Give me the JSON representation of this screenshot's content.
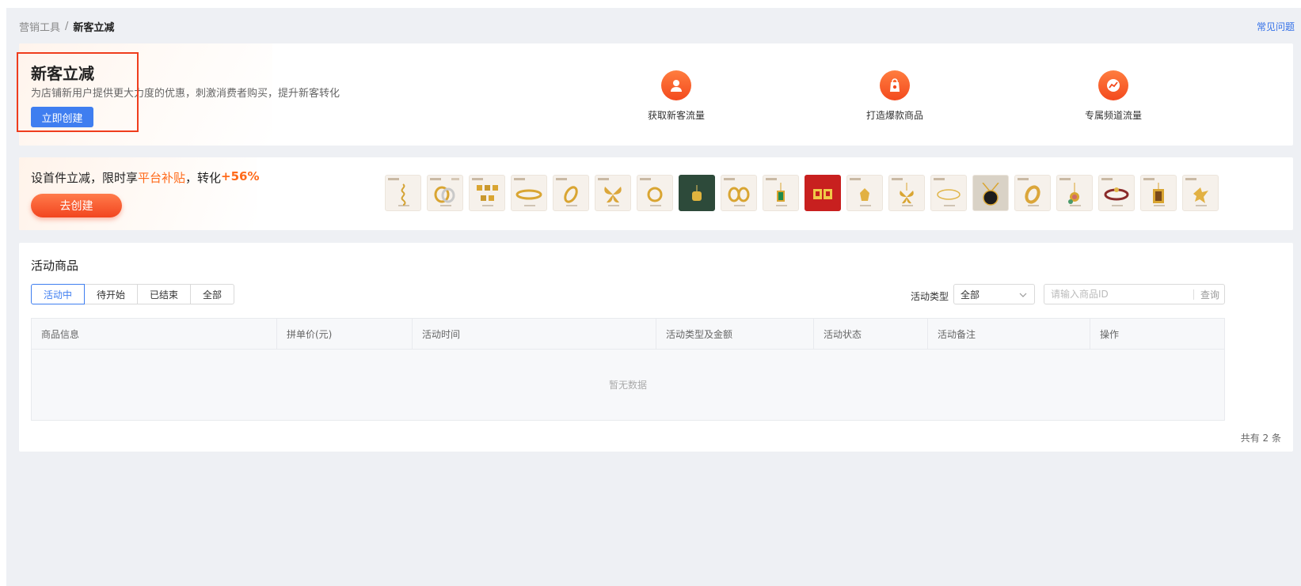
{
  "breadcrumb": {
    "parent": "营销工具",
    "separator": "/",
    "current": "新客立减"
  },
  "faq_link": "常见问题",
  "hero": {
    "title": "新客立减",
    "subtitle": "为店铺新用户提供更大力度的优惠，刺激消费者购买，提升新客转化",
    "create_button": "立即创建",
    "features": [
      {
        "label": "获取新客流量",
        "icon": "user-icon"
      },
      {
        "label": "打造爆款商品",
        "icon": "shopping-bag-icon"
      },
      {
        "label": "专属频道流量",
        "icon": "trend-icon"
      }
    ]
  },
  "promo": {
    "title_part1": "设首件立减，限时享",
    "title_highlight": "平台补贴",
    "title_part2": "，转化",
    "title_boost": "+56%",
    "go_button": "去创建",
    "product_thumbnails": [
      "snake-pendant-icon",
      "ring-pair-icon",
      "charm-set-icon",
      "bracelet-icon",
      "ring-icon",
      "butterfly-pendant-icon",
      "ring-icon",
      "gold-bead-icon",
      "earring-icon",
      "emerald-pendant-icon",
      "gold-bar-icon",
      "gold-ornament-icon",
      "butterfly-pendant-icon",
      "chain-bracelet-icon",
      "onyx-pendant-icon",
      "ring-icon",
      "flower-pendant-icon",
      "bead-bracelet-icon",
      "framed-pendant-icon",
      "bird-pendant-icon"
    ]
  },
  "activity": {
    "title": "活动商品",
    "tabs": [
      {
        "label": "活动中",
        "active": true
      },
      {
        "label": "待开始",
        "active": false
      },
      {
        "label": "已结束",
        "active": false
      },
      {
        "label": "全部",
        "active": false
      }
    ],
    "type_filter": {
      "label": "活动类型",
      "selected": "全部"
    },
    "search": {
      "placeholder": "请输入商品ID",
      "button": "查询"
    },
    "table": {
      "columns": [
        "商品信息",
        "拼单价(元)",
        "活动时间",
        "活动类型及金额",
        "活动状态",
        "活动备注",
        "操作"
      ],
      "rows": [],
      "empty_text": "暂无数据"
    },
    "total": "共有 2 条"
  },
  "colors": {
    "accent": "#3f7ef0",
    "highlight": "#ff6a1a",
    "annotation_box": "#ef3d1d"
  }
}
